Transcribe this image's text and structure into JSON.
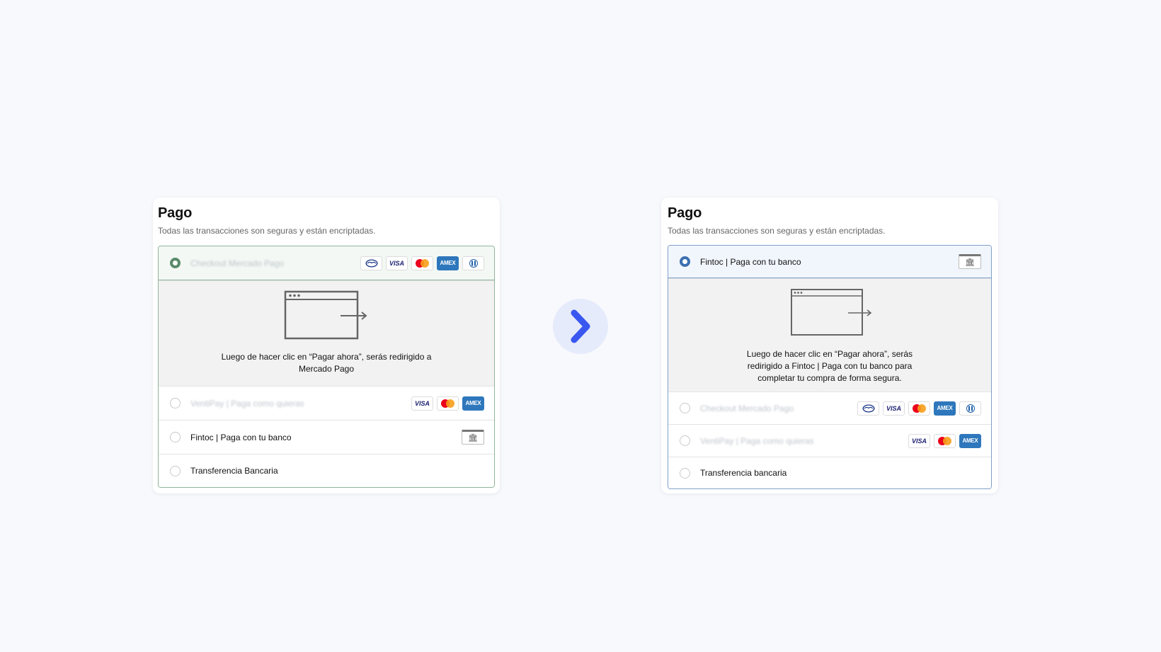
{
  "colors": {
    "left_selected": "#5a8a6a",
    "right_selected": "#3b6fb0",
    "arrow": "#3a57f0"
  },
  "left": {
    "title": "Pago",
    "subtitle": "Todas las transacciones son seguras y están encriptadas.",
    "selected": {
      "label": "Checkout Mercado Pago",
      "cards": [
        "mercadopago",
        "VISA",
        "mastercard",
        "AMEX",
        "diners"
      ]
    },
    "redirect_message": "Luego de hacer clic en “Pagar ahora”, serás redirigido a Mercado Pago",
    "options": [
      {
        "label": "VentiPay | Paga como quieras",
        "cards": [
          "VISA",
          "mastercard",
          "AMEX"
        ]
      },
      {
        "label": "Fintoc | Paga con tu banco",
        "icon": "bank-icon"
      },
      {
        "label": "Transferencia Bancaria"
      }
    ]
  },
  "right": {
    "title": "Pago",
    "subtitle": "Todas las transacciones son seguras y están encriptadas.",
    "selected": {
      "label": "Fintoc | Paga con tu banco",
      "icon": "bank-icon"
    },
    "redirect_message": "Luego de hacer clic en “Pagar ahora”, serás redirigido a Fintoc | Paga con tu banco para completar tu compra de forma segura.",
    "options": [
      {
        "label": "Checkout Mercado Pago",
        "cards": [
          "mercadopago",
          "VISA",
          "mastercard",
          "AMEX",
          "diners"
        ]
      },
      {
        "label": "VentiPay | Paga como quieras",
        "cards": [
          "VISA",
          "mastercard",
          "AMEX"
        ]
      },
      {
        "label": "Transferencia bancaria"
      }
    ]
  },
  "card_labels": {
    "visa": "VISA",
    "amex": "AMEX"
  }
}
